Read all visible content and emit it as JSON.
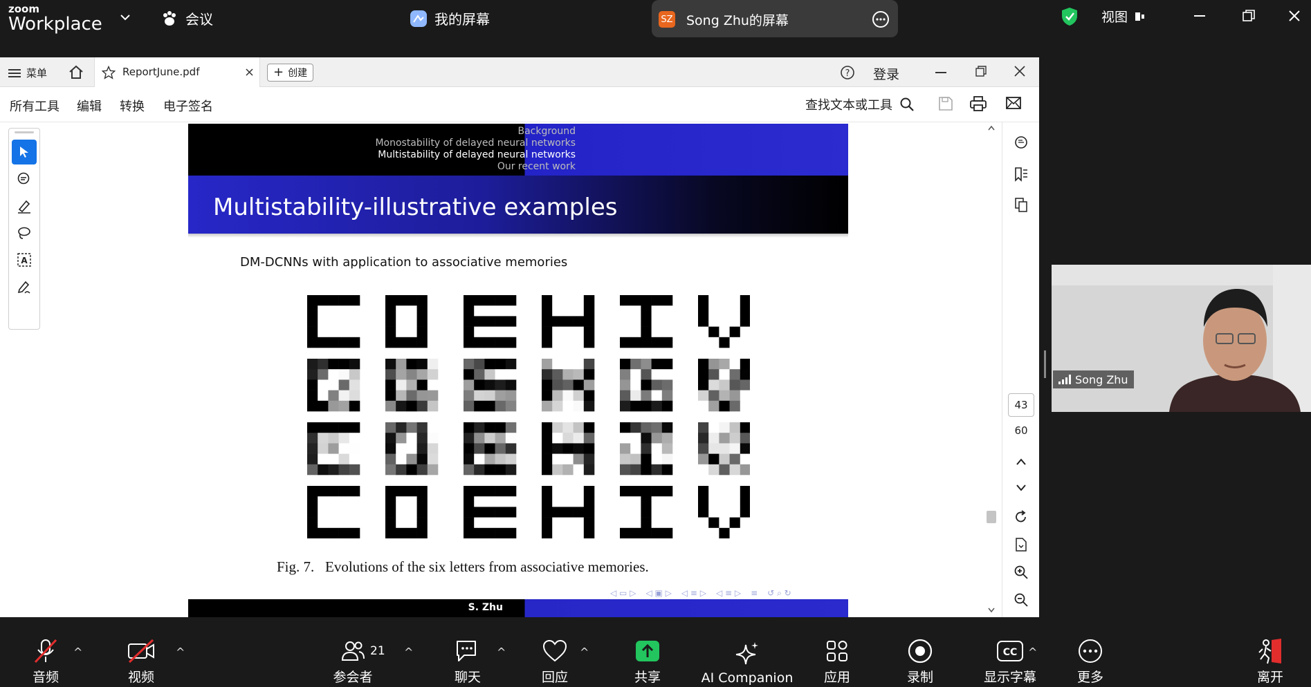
{
  "zoom": {
    "logo_small": "zoom",
    "logo_big": "Workplace",
    "meeting_label": "会议",
    "my_screen_label": "我的屏幕",
    "share_initials": "SZ",
    "share_label": "Song Zhu的屏幕",
    "view_label": "视图",
    "colors": {
      "bar_bg": "#1a1a1a",
      "share_badge": "#e8661e",
      "shield": "#22c55e",
      "share_green": "#22c55e"
    }
  },
  "acrobat": {
    "menu_label": "菜单",
    "tab_title": "ReportJune.pdf",
    "create_label": "创建",
    "login_label": "登录",
    "tools": {
      "all_tools": "所有工具",
      "edit": "编辑",
      "convert": "转换",
      "esign": "电子签名"
    },
    "search_label": "查找文本或工具",
    "page_current": "43",
    "page_total": "60"
  },
  "slide": {
    "nav": [
      "Background",
      "Monostability of delayed neural networks",
      "Multistability of delayed neural networks",
      "Our recent work"
    ],
    "title": "Multistability-illustrative examples",
    "subtitle": "DM-DCNNs with application to associative memories",
    "caption": "Fig. 7.   Evolutions of the six letters from associative memories.",
    "footer_author": "S. Zhu",
    "letters": [
      "C",
      "D",
      "E",
      "H",
      "I",
      "V"
    ]
  },
  "video": {
    "participant": "Song Zhu"
  },
  "bottom": {
    "audio": "音频",
    "video": "视频",
    "participants": "参会者",
    "participant_count": "21",
    "chat": "聊天",
    "react": "回应",
    "share": "共享",
    "ai": "AI Companion",
    "apps": "应用",
    "record": "录制",
    "captions": "显示字幕",
    "more": "更多",
    "leave": "离开"
  }
}
